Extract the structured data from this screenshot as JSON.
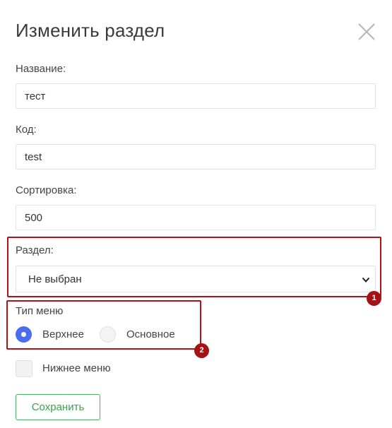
{
  "dialog": {
    "title": "Изменить раздел"
  },
  "form": {
    "name": {
      "label": "Название:",
      "value": "тест"
    },
    "code": {
      "label": "Код:",
      "value": "test"
    },
    "sort": {
      "label": "Сортировка:",
      "value": "500"
    },
    "section": {
      "label": "Раздел:",
      "selected": "Не выбран"
    },
    "menu_type": {
      "label": "Тип меню",
      "options": [
        {
          "label": "Верхнее",
          "checked": true
        },
        {
          "label": "Основное",
          "checked": false
        }
      ]
    },
    "bottom_menu": {
      "label": "Нижнее меню",
      "checked": false
    },
    "save_label": "Сохранить"
  },
  "annotations": [
    {
      "number": "1"
    },
    {
      "number": "2"
    }
  ],
  "colors": {
    "highlight": "#b01217",
    "badge": "#a81114",
    "radio_accent": "#4a6cf0",
    "save_button": "#3da150"
  }
}
